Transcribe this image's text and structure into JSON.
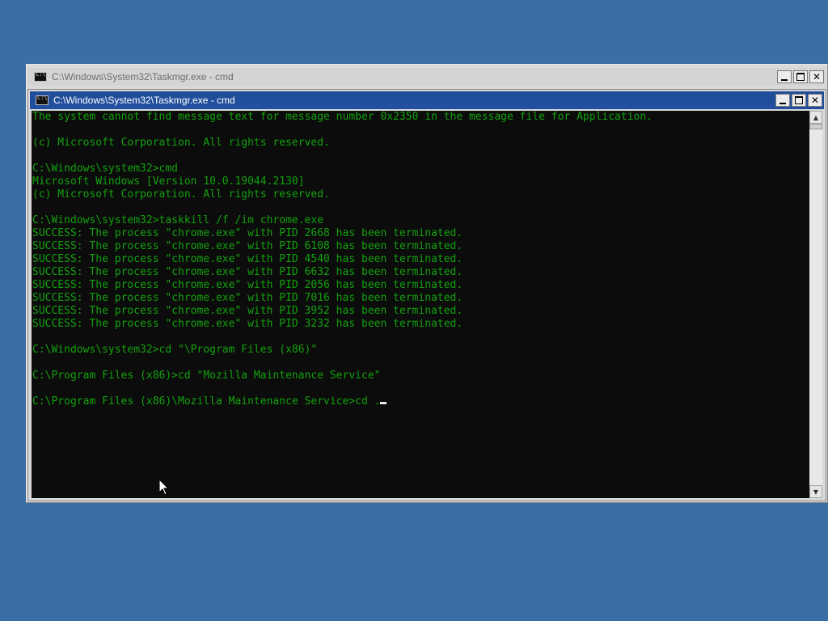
{
  "desktop": {
    "background": "#3a6ea5"
  },
  "back_window": {
    "title": "C:\\Windows\\System32\\Taskmgr.exe - cmd",
    "controls": {
      "minimize": "",
      "maximize": "",
      "close": "✕"
    }
  },
  "front_window": {
    "title": "C:\\Windows\\System32\\Taskmgr.exe - cmd",
    "controls": {
      "minimize": "",
      "maximize": "",
      "close": "✕"
    },
    "text_color": "#13a10e",
    "lines": [
      "The system cannot find message text for message number 0x2350 in the message file for Application.",
      "",
      "(c) Microsoft Corporation. All rights reserved.",
      "",
      "C:\\Windows\\system32>cmd",
      "Microsoft Windows [Version 10.0.19044.2130]",
      "(c) Microsoft Corporation. All rights reserved.",
      "",
      "C:\\Windows\\system32>taskkill /f /im chrome.exe",
      "SUCCESS: The process \"chrome.exe\" with PID 2668 has been terminated.",
      "SUCCESS: The process \"chrome.exe\" with PID 6108 has been terminated.",
      "SUCCESS: The process \"chrome.exe\" with PID 4540 has been terminated.",
      "SUCCESS: The process \"chrome.exe\" with PID 6632 has been terminated.",
      "SUCCESS: The process \"chrome.exe\" with PID 2056 has been terminated.",
      "SUCCESS: The process \"chrome.exe\" with PID 7016 has been terminated.",
      "SUCCESS: The process \"chrome.exe\" with PID 3952 has been terminated.",
      "SUCCESS: The process \"chrome.exe\" with PID 3232 has been terminated.",
      "",
      "C:\\Windows\\system32>cd \"\\Program Files (x86)\"",
      "",
      "C:\\Program Files (x86)>cd \"Mozilla Maintenance Service\"",
      ""
    ],
    "prompt": "C:\\Program Files (x86)\\Mozilla Maintenance Service>cd .",
    "scrollbar": {
      "up_arrow": "▲",
      "down_arrow": "▼"
    }
  }
}
